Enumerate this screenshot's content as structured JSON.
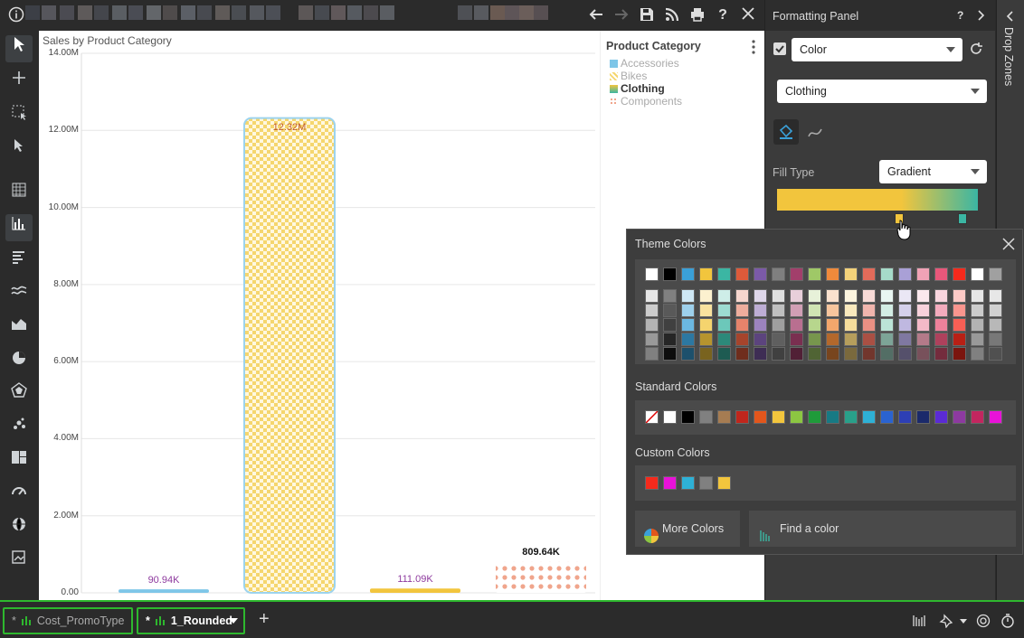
{
  "toolbar": {
    "info_icon": "info-icon",
    "back_icon": "arrow-left-icon",
    "forward_icon": "arrow-right-icon",
    "save_icon": "save-icon",
    "rss_icon": "rss-icon",
    "print_icon": "print-icon",
    "help_label": "?",
    "close_icon": "close-icon"
  },
  "chart_data": {
    "type": "bar",
    "title": "Sales by Product Category",
    "categories": [
      "Accessories",
      "Bikes",
      "Clothing",
      "Components"
    ],
    "values": [
      90940,
      12320000,
      111090,
      809640
    ],
    "data_labels": [
      "90.94K",
      "12.32M",
      "111.09K",
      "809.64K"
    ],
    "colors": [
      "#7ec6e8",
      "#f5d66e",
      "#d4b53c",
      "#f0a58c"
    ],
    "label_colors": [
      "#8e3a9e",
      "#c05a2a",
      "#8e3a9e",
      "#111111"
    ],
    "ylim": [
      0,
      14000000
    ],
    "yticks": [
      "0.00",
      "2.00M",
      "4.00M",
      "6.00M",
      "8.00M",
      "10.00M",
      "12.00M",
      "14.00M"
    ],
    "grid": true,
    "legend_position": "right"
  },
  "legend": {
    "title": "Product Category",
    "items": [
      {
        "label": "Accessories",
        "color": "#7ec6e8",
        "highlight": false
      },
      {
        "label": "Bikes",
        "color": "#f5d66e",
        "highlight": false
      },
      {
        "label": "Clothing",
        "color": "#d4b53c",
        "highlight": true
      },
      {
        "label": "Components",
        "color": "#f0a58c",
        "highlight": false
      }
    ]
  },
  "formatting_panel": {
    "title": "Formatting Panel",
    "help_label": "?",
    "property_select": "Color",
    "member_select": "Clothing",
    "fill_type_label": "Fill Type",
    "fill_type_value": "Gradient",
    "gradient_start": "#f2c53d",
    "gradient_end": "#3bb6a3"
  },
  "drop_zones": {
    "label": "Drop Zones"
  },
  "color_popup": {
    "theme_title": "Theme Colors",
    "standard_title": "Standard Colors",
    "custom_title": "Custom Colors",
    "more_colors_label": "More Colors",
    "find_color_label": "Find a color",
    "theme_base": [
      "#ffffff",
      "#000000",
      "#3aa0d8",
      "#f2c53d",
      "#3bb6a3",
      "#dd5a3a",
      "#7b5aa8",
      "#7f7f7f",
      "#a23f6b",
      "#9fc867",
      "#ef8a3b",
      "#f3d27a",
      "#e36b5a",
      "#a6dbc9",
      "#a9a0d6",
      "#f0a2b6",
      "#e8577a",
      "#f52a1c",
      "#ffffff",
      "#a0a0a0"
    ],
    "standard": [
      "none",
      "#ffffff",
      "#000000",
      "#808080",
      "#a67c52",
      "#c0261c",
      "#e2561c",
      "#f2c53d",
      "#8cc642",
      "#1f9b3a",
      "#177a84",
      "#29a08a",
      "#2eb1d6",
      "#2a63d0",
      "#2d3fb5",
      "#1b2a6b",
      "#5b2bd5",
      "#8d3aa0",
      "#c2265f",
      "#e812d8"
    ],
    "custom": [
      "#f52a1c",
      "#e812d8",
      "#2eb1d6",
      "#808080",
      "#f2c53d"
    ]
  },
  "tabs": {
    "tab1_label": "Cost_PromoType",
    "tab1_prefix": "*",
    "tab2_label": "1_Rounded",
    "tab2_prefix": "*",
    "add_label": "+"
  }
}
